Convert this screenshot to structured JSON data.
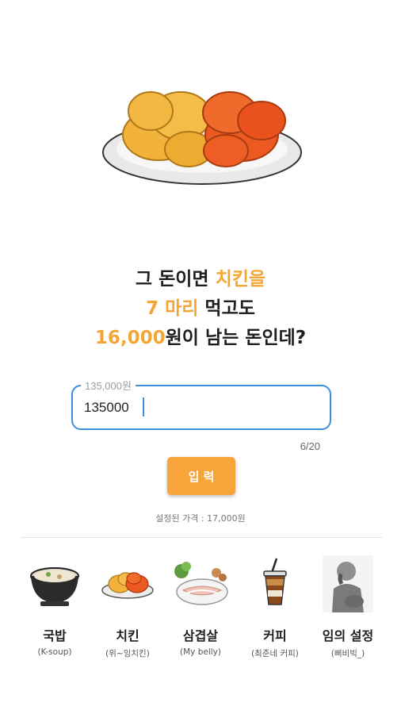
{
  "hero": {
    "icon": "fried-chicken-plate-icon"
  },
  "headline": {
    "line1_pre": "그 돈이면 ",
    "line1_accent": "치킨을",
    "line2_accent": "7 마리",
    "line2_post": " 먹고도",
    "line3_accent": "16,000",
    "line3_post": "원이 남는 돈인데?"
  },
  "input": {
    "label": "135,000원",
    "value": "135000",
    "counter": "6/20"
  },
  "submit_label": "입 력",
  "price_note": "설정된 가격 : 17,000원",
  "categories": [
    {
      "name": "국밥",
      "sub": "(K-soup)",
      "icon": "gukbap-bowl-icon"
    },
    {
      "name": "치킨",
      "sub": "(위~잉치킨)",
      "icon": "chicken-plate-icon"
    },
    {
      "name": "삼겹살",
      "sub": "(My belly)",
      "icon": "pork-belly-plate-icon"
    },
    {
      "name": "커피",
      "sub": "(최준네 커피)",
      "icon": "iced-coffee-cup-icon"
    },
    {
      "name": "임의 설정",
      "sub": "(삐비빅_)",
      "icon": "thinking-statue-icon"
    }
  ],
  "colors": {
    "accent": "#f5a533",
    "focus": "#3d8fe0",
    "button": "#f7a53a"
  }
}
